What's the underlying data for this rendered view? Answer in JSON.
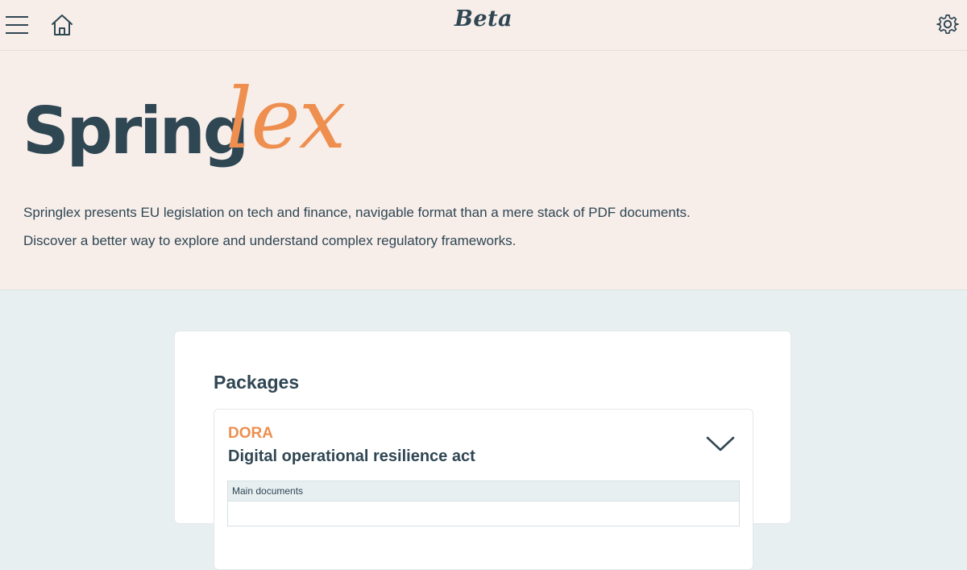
{
  "topbar": {
    "brand": "Beta",
    "icons": [
      "menu-icon",
      "home-icon",
      "gear-icon"
    ]
  },
  "hero": {
    "logo_part1": "Spring",
    "logo_part2": "lex",
    "line1": "Springlex presents EU legislation on tech and finance, navigable format than a mere stack of PDF documents.",
    "line2": "Discover a better way to explore and understand complex regulatory frameworks."
  },
  "packages": {
    "title": "Packages",
    "items": [
      {
        "code": "DORA",
        "name": "Digital operational resilience act",
        "table_header": "Main documents"
      }
    ]
  },
  "colors": {
    "primary": "#2f4653",
    "accent": "#ee8f4f",
    "hero_bg": "#f7eeea",
    "page_bg": "#e7eff1"
  }
}
